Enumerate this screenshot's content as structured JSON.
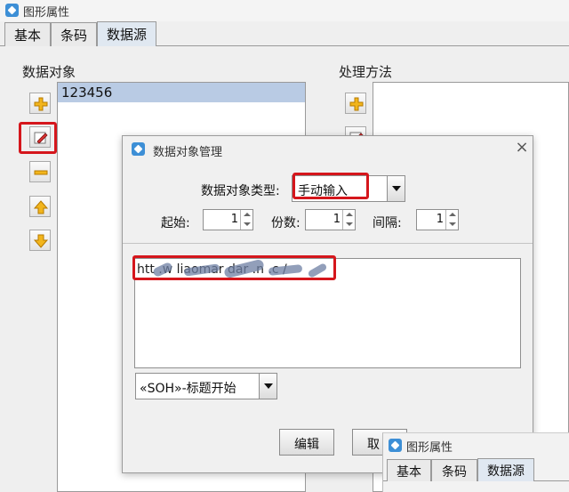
{
  "window": {
    "title": "图形属性",
    "tabs": [
      {
        "label": "基本",
        "active": false
      },
      {
        "label": "条码",
        "active": false
      },
      {
        "label": "数据源",
        "active": true
      }
    ]
  },
  "data_object_panel": {
    "label": "数据对象",
    "items": [
      "123456"
    ]
  },
  "processing_panel": {
    "label": "处理方法"
  },
  "dialog": {
    "title": "数据对象管理",
    "close_glyph": "×",
    "type_label": "数据对象类型:",
    "type_value": "手动输入",
    "start_label": "起始:",
    "start_value": "1",
    "copies_label": "份数:",
    "copies_value": "1",
    "interval_label": "间隔:",
    "interval_value": "1",
    "content_text": "htt      .w   liaomar  dar  .n .c     /",
    "control_char": "«SOH»-标题开始",
    "edit_button": "编辑",
    "cancel_button_partial": "取"
  },
  "second_window": {
    "title": "图形属性",
    "tabs": [
      "基本",
      "条码",
      "数据源"
    ]
  },
  "colors": {
    "highlight_red": "#d5161c",
    "selection_blue": "#b9cbe4",
    "active_tab": "#e0e8f1"
  },
  "icons": [
    "add-icon",
    "edit-icon",
    "remove-icon",
    "move-up-icon",
    "move-down-icon",
    "close-icon",
    "dropdown-arrow-icon",
    "app-icon"
  ]
}
